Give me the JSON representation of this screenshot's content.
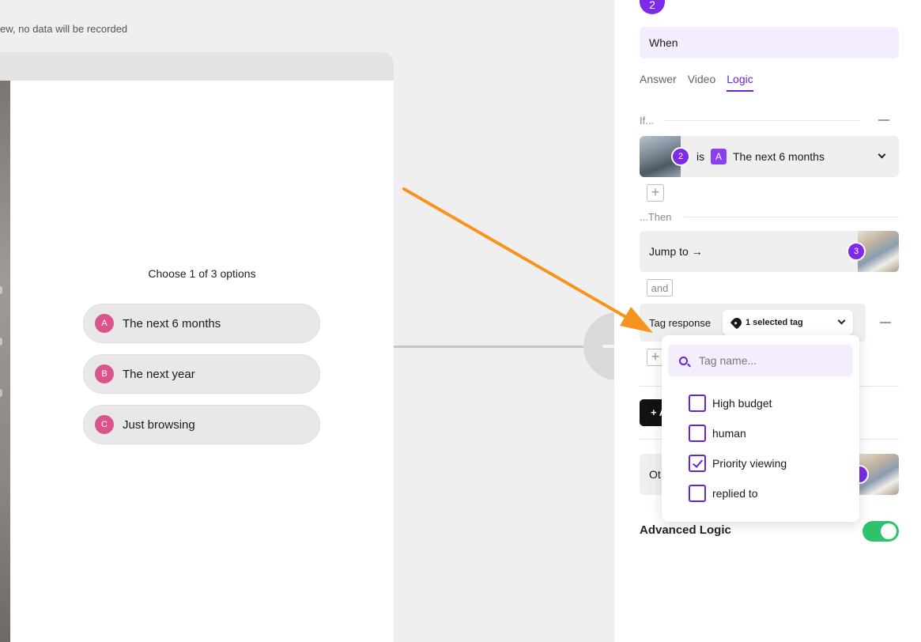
{
  "canvas": {
    "preview_note": "ew, no data will be recorded"
  },
  "question": {
    "title": "Choose 1 of 3 options",
    "options": [
      {
        "letter": "A",
        "label": "The next 6 months"
      },
      {
        "letter": "B",
        "label": "The next year"
      },
      {
        "letter": "C",
        "label": "Just browsing"
      }
    ]
  },
  "panel": {
    "step_number": "2",
    "when_text": "When",
    "tabs": [
      "Answer",
      "Video",
      "Logic"
    ],
    "active_tab": "Logic",
    "if_label": "If...",
    "condition": {
      "step_number": "2",
      "operator": "is",
      "letter": "A",
      "value": "The next 6 months"
    },
    "then_label": "...Then",
    "jump": {
      "label": "Jump to →",
      "target_step": "3"
    },
    "and_label": "and",
    "tag_response": {
      "label": "Tag response",
      "selected_text": "1 selected tag"
    },
    "add_button_label": "+ A",
    "other_label": "Ot",
    "advanced_logic_label": "Advanced Logic",
    "advanced_logic_enabled": true
  },
  "dropdown": {
    "search_placeholder": "Tag name...",
    "tags": [
      {
        "label": "High budget",
        "checked": false
      },
      {
        "label": "human",
        "checked": false
      },
      {
        "label": "Priority viewing",
        "checked": true
      },
      {
        "label": "replied to",
        "checked": false
      }
    ]
  },
  "colors": {
    "accent_purple": "#7c2be8",
    "option_letter_pink": "#d9558c",
    "toggle_green": "#2ec26b",
    "arrow_orange": "#f7941d"
  }
}
